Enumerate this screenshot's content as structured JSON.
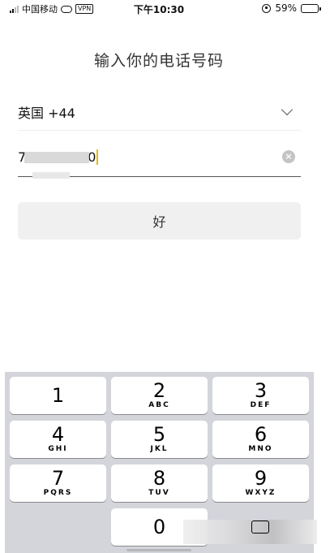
{
  "status_bar": {
    "carrier": "中国移动",
    "vpn": "VPN",
    "time": "下午10:30",
    "battery_percent": "59%",
    "battery_level": 0.59,
    "icons": [
      "signal-icon",
      "link-icon",
      "vpn-icon",
      "orientation-lock-icon",
      "battery-icon"
    ]
  },
  "title": "输入你的电话号码",
  "country": {
    "label": "英国 +44",
    "icon": "chevron-down-icon"
  },
  "phone": {
    "prefix": "7",
    "suffix": "0",
    "clear_icon": "×"
  },
  "ok_label": "好",
  "keypad": {
    "keys": [
      {
        "digit": "1",
        "letters": ""
      },
      {
        "digit": "2",
        "letters": "ABC"
      },
      {
        "digit": "3",
        "letters": "DEF"
      },
      {
        "digit": "4",
        "letters": "GHI"
      },
      {
        "digit": "5",
        "letters": "JKL"
      },
      {
        "digit": "6",
        "letters": "MNO"
      },
      {
        "digit": "7",
        "letters": "PQRS"
      },
      {
        "digit": "8",
        "letters": "TUV"
      },
      {
        "digit": "9",
        "letters": "WXYZ"
      },
      {
        "digit": "0",
        "letters": ""
      }
    ]
  },
  "colors": {
    "caret": "#e6b800",
    "keypad_bg": "#d3d5db",
    "button_bg": "#f0f0f0"
  }
}
